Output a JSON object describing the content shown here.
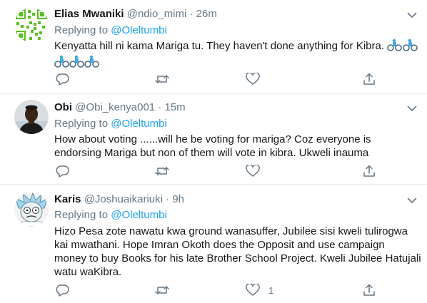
{
  "tweets": [
    {
      "name": "Elias Mwaniki",
      "handle": "@ndio_mimi",
      "separator": "·",
      "time": "26m",
      "replying_prefix": "Replying to",
      "replying_to": "@Oleltumbi",
      "text_lines": [
        "Kenyatta hill ni kama Mariga tu. They haven't done anything for Kibra."
      ],
      "emoji": "🚴",
      "like_count": ""
    },
    {
      "name": "Obi",
      "handle": "@Obi_kenya001",
      "separator": "·",
      "time": "15m",
      "replying_prefix": "Replying to",
      "replying_to": "@Oleltumbi",
      "text_lines": [
        "How about  voting ......will he be voting for mariga? Coz everyone is",
        "endorsing Mariga but non of them will vote in kibra. Ukweli inauma"
      ],
      "like_count": ""
    },
    {
      "name": "Karis",
      "handle": "@Joshuaikariuki",
      "separator": "·",
      "time": "9h",
      "replying_prefix": "Replying to",
      "replying_to": "@Oleltumbi",
      "text_lines": [
        "Hizo Pesa zote nawatu kwa ground wanasuffer, Jubilee sisi kweli tulirogwa",
        "kai mwathani. Hope Imran Okoth does the Opposit and use campaign",
        "money to buy Books for his late Brother School Project. Kweli Jubilee Hatujali",
        "watu waKibra."
      ],
      "like_count": "1"
    }
  ],
  "icons": {
    "reply": "reply-icon",
    "retweet": "retweet-icon",
    "like": "heart-icon",
    "share": "share-icon",
    "caret": "chevron-down-icon"
  },
  "colors": {
    "text": "#14171a",
    "secondary": "#657786",
    "link": "#1da1f2",
    "divider": "#e6ecf0"
  }
}
